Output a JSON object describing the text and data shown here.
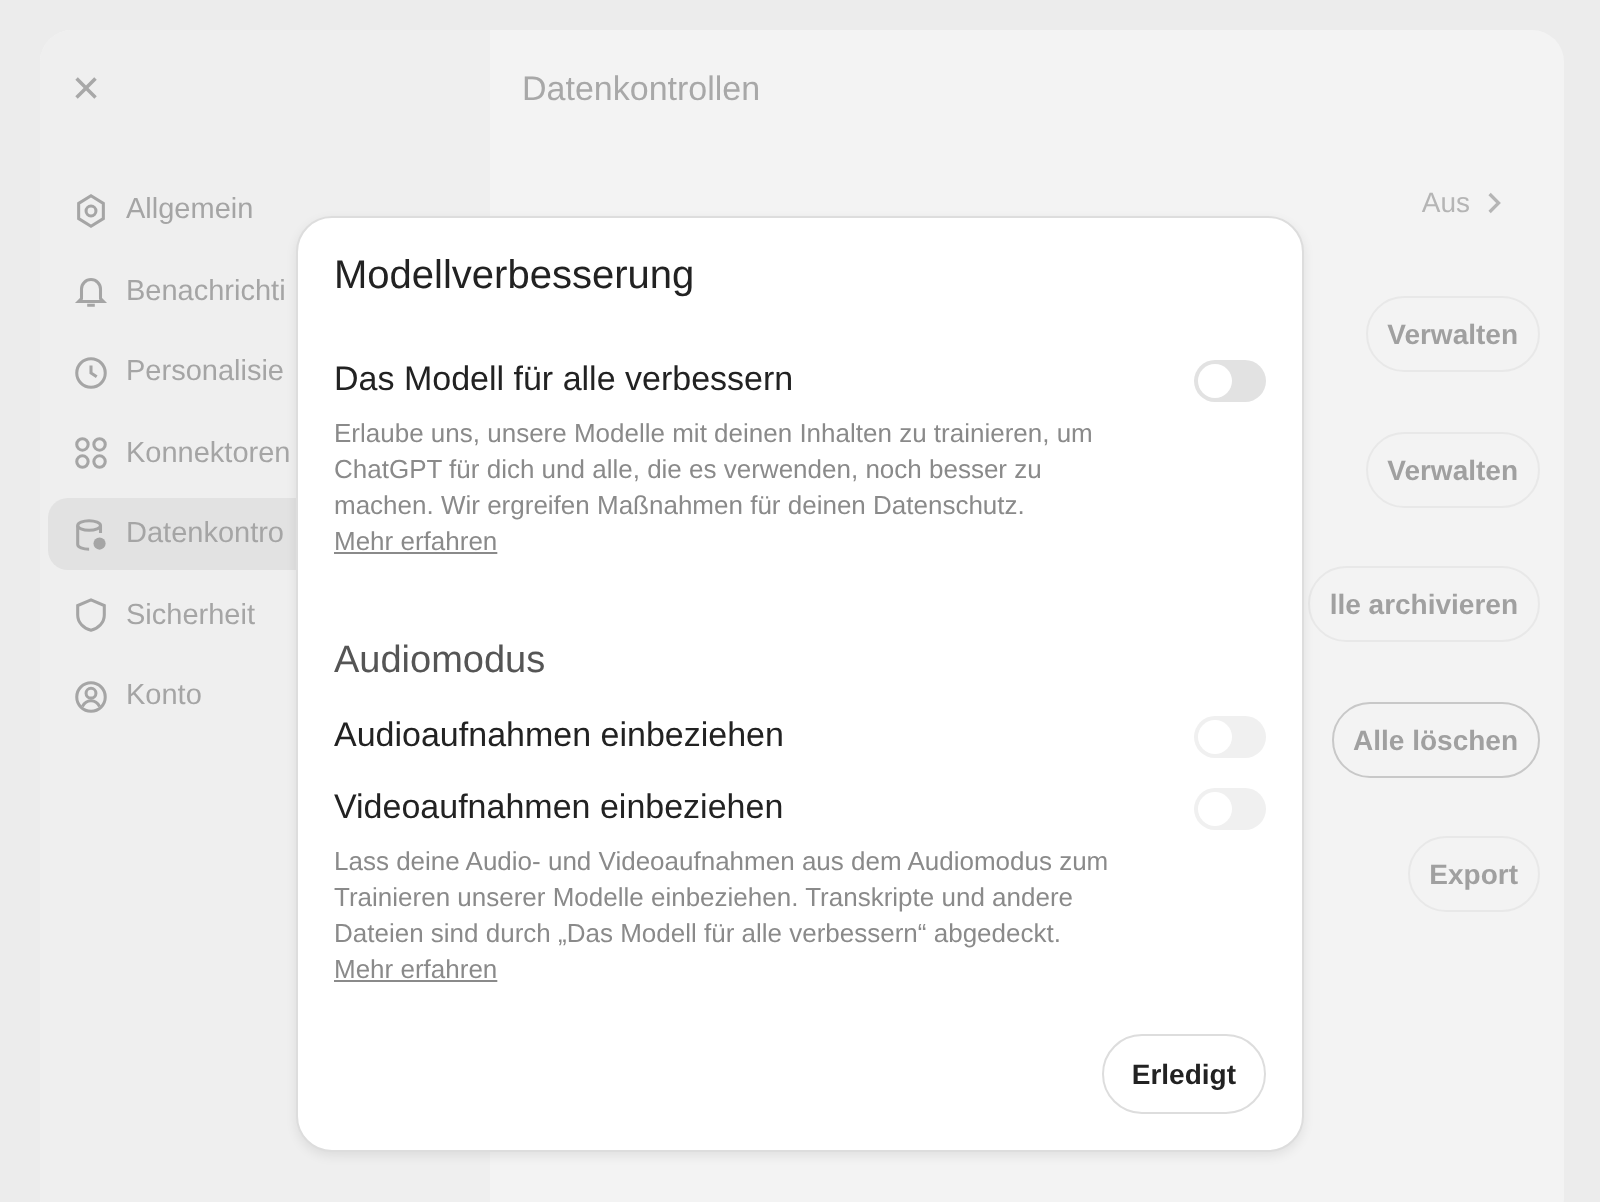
{
  "sidebar": {
    "close": "×",
    "items": [
      {
        "label": "Allgemein",
        "selected": false
      },
      {
        "label": "Benachrichti",
        "selected": false
      },
      {
        "label": "Personalisie",
        "selected": false
      },
      {
        "label": "Konnektoren",
        "selected": false
      },
      {
        "label": "Datenkontro",
        "selected": true
      },
      {
        "label": "Sicherheit",
        "selected": false
      },
      {
        "label": "Konto",
        "selected": false
      }
    ]
  },
  "main": {
    "title": "Datenkontrollen",
    "rows": [
      {
        "kind": "link",
        "label": "Aus"
      },
      {
        "kind": "button",
        "label": "Verwalten",
        "outlined": false
      },
      {
        "kind": "button",
        "label": "Verwalten",
        "outlined": false
      },
      {
        "kind": "button",
        "label": "lle archivieren",
        "outlined": false
      },
      {
        "kind": "button",
        "label": "Alle löschen",
        "outlined": true
      },
      {
        "kind": "button",
        "label": "Export",
        "outlined": false
      }
    ]
  },
  "dialog": {
    "title": "Modellverbesserung",
    "sections": [
      {
        "settings": [
          {
            "label": "Das Modell für alle verbessern",
            "on": false,
            "disabled": false
          }
        ],
        "description": "Erlaube uns, unsere Modelle mit deinen Inhalten zu trainieren, um ChatGPT für dich und alle, die es verwenden, noch besser zu machen. Wir ergreifen Maßnahmen für deinen Datenschutz.",
        "link": "Mehr erfahren"
      },
      {
        "heading": "Audiomodus",
        "settings": [
          {
            "label": "Audioaufnahmen einbeziehen",
            "on": false,
            "disabled": true
          },
          {
            "label": "Videoaufnahmen einbeziehen",
            "on": false,
            "disabled": true
          }
        ],
        "description": "Lass deine Audio- und Videoaufnahmen aus dem Audiomodus zum Trainieren unserer Modelle einbeziehen. Transkripte und andere Dateien sind durch „Das Modell für alle verbessern“ abgedeckt.",
        "link": "Mehr erfahren"
      }
    ],
    "done_button": "Erledigt"
  }
}
